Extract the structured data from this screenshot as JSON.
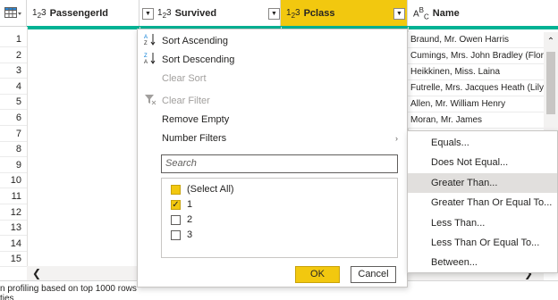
{
  "header": {
    "columns": [
      {
        "type_main": "1",
        "type_sub": "2",
        "type_tail": "3",
        "name": "PassengerId"
      },
      {
        "type_main": "1",
        "type_sub": "2",
        "type_tail": "3",
        "name": "Survived"
      },
      {
        "type_main": "1",
        "type_sub": "2",
        "type_tail": "3",
        "name": "Pclass"
      },
      {
        "type_main": "A",
        "type_sub": "B",
        "type_tail": "C",
        "name": "Name"
      }
    ],
    "dropdown_glyph": "▼"
  },
  "rows": {
    "numbers": [
      "1",
      "2",
      "3",
      "4",
      "5",
      "6",
      "7",
      "8",
      "9",
      "10",
      "11",
      "12",
      "13",
      "14",
      "15"
    ],
    "names": [
      "Braund, Mr. Owen Harris",
      "Cumings, Mrs. John Bradley (Flore",
      "Heikkinen, Miss. Laina",
      "Futrelle, Mrs. Jacques Heath (Lily M",
      "Allen, Mr. William Henry",
      "Moran, Mr. James"
    ]
  },
  "menu": {
    "sort_ascending": "Sort Ascending",
    "sort_descending": "Sort Descending",
    "clear_sort": "Clear Sort",
    "clear_filter": "Clear Filter",
    "remove_empty": "Remove Empty",
    "number_filters": "Number Filters",
    "search_placeholder": "Search",
    "values": [
      {
        "label": "(Select All)",
        "state": "partial"
      },
      {
        "label": "1",
        "state": "checked"
      },
      {
        "label": "2",
        "state": "unchecked"
      },
      {
        "label": "3",
        "state": "unchecked"
      }
    ],
    "ok": "OK",
    "cancel": "Cancel"
  },
  "submenu": {
    "items": [
      "Equals...",
      "Does Not Equal...",
      "Greater Than...",
      "Greater Than Or Equal To...",
      "Less Than...",
      "Less Than Or Equal To...",
      "Between..."
    ],
    "highlighted": "Greater Than..."
  },
  "status": {
    "profiling": "n profiling based on top 1000 rows",
    "cutoff": "ties"
  },
  "colors": {
    "accent_yellow": "#f2c80f",
    "teal": "#00b294",
    "highlight": "#e1dfdd"
  },
  "icons": [
    "table-icon",
    "number-type-icon",
    "text-type-icon",
    "dropdown-arrow-icon",
    "sort-ascending-icon",
    "sort-descending-icon",
    "clear-filter-icon",
    "chevron-right-icon",
    "scroll-up-icon",
    "scroll-left-icon",
    "scroll-right-icon"
  ]
}
